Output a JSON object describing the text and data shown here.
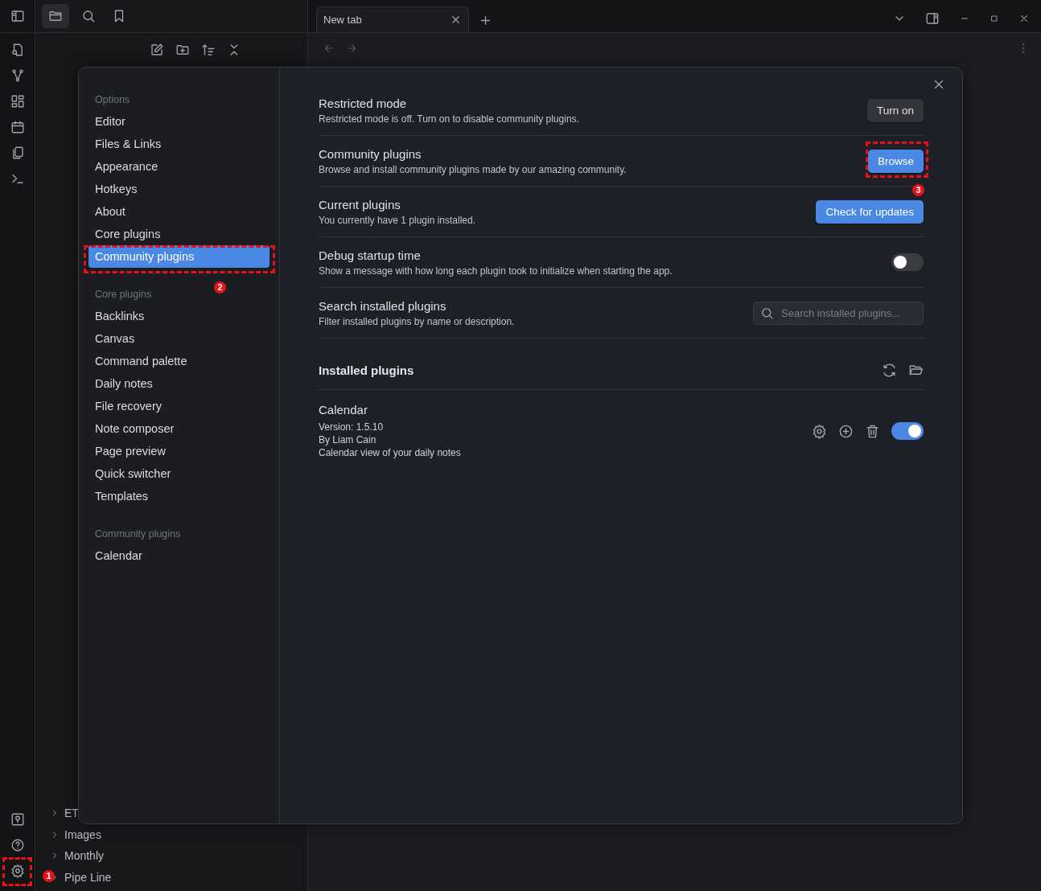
{
  "tabs": [
    {
      "label": "New tab",
      "selected": true
    }
  ],
  "explorer": {
    "tree": [
      {
        "label": "ET",
        "expanded": false
      },
      {
        "label": "Images",
        "expanded": false
      },
      {
        "label": "Monthly",
        "expanded": false
      },
      {
        "label": "Pipe Line",
        "expanded": false
      }
    ]
  },
  "settings": {
    "nav": [
      {
        "heading": "Options",
        "items": [
          {
            "label": "Editor",
            "selected": false
          },
          {
            "label": "Files & Links",
            "selected": false
          },
          {
            "label": "Appearance",
            "selected": false
          },
          {
            "label": "Hotkeys",
            "selected": false
          },
          {
            "label": "About",
            "selected": false
          },
          {
            "label": "Core plugins",
            "selected": false
          },
          {
            "label": "Community plugins",
            "selected": true
          }
        ]
      },
      {
        "heading": "Core plugins",
        "items": [
          {
            "label": "Backlinks",
            "selected": false
          },
          {
            "label": "Canvas",
            "selected": false
          },
          {
            "label": "Command palette",
            "selected": false
          },
          {
            "label": "Daily notes",
            "selected": false
          },
          {
            "label": "File recovery",
            "selected": false
          },
          {
            "label": "Note composer",
            "selected": false
          },
          {
            "label": "Page preview",
            "selected": false
          },
          {
            "label": "Quick switcher",
            "selected": false
          },
          {
            "label": "Templates",
            "selected": false
          }
        ]
      },
      {
        "heading": "Community plugins",
        "items": [
          {
            "label": "Calendar",
            "selected": false
          }
        ]
      }
    ],
    "rows": [
      {
        "name": "Restricted mode",
        "description": "Restricted mode is off. Turn on to disable community plugins.",
        "kind": "button",
        "label": "Turn on",
        "primary": false
      },
      {
        "name": "Community plugins",
        "description": "Browse and install community plugins made by our amazing community.",
        "kind": "button",
        "label": "Browse",
        "primary": true
      },
      {
        "name": "Current plugins",
        "description": "You currently have 1 plugin installed.",
        "kind": "button",
        "label": "Check for updates",
        "primary": true
      },
      {
        "name": "Debug startup time",
        "description": "Show a message with how long each plugin took to initialize when starting the app.",
        "kind": "toggle",
        "on": false
      },
      {
        "name": "Search installed plugins",
        "description": "Filter installed plugins by name or description.",
        "kind": "search",
        "placeholder": "Search installed plugins..."
      }
    ],
    "installed_heading": "Installed plugins",
    "plugins": [
      {
        "name": "Calendar",
        "version": "Version: 1.5.10",
        "author": "By Liam Cain",
        "description": "Calendar view of your daily notes",
        "enabled": true
      }
    ]
  },
  "annotations": [
    {
      "label": "1"
    },
    {
      "label": "2"
    },
    {
      "label": "3"
    }
  ]
}
